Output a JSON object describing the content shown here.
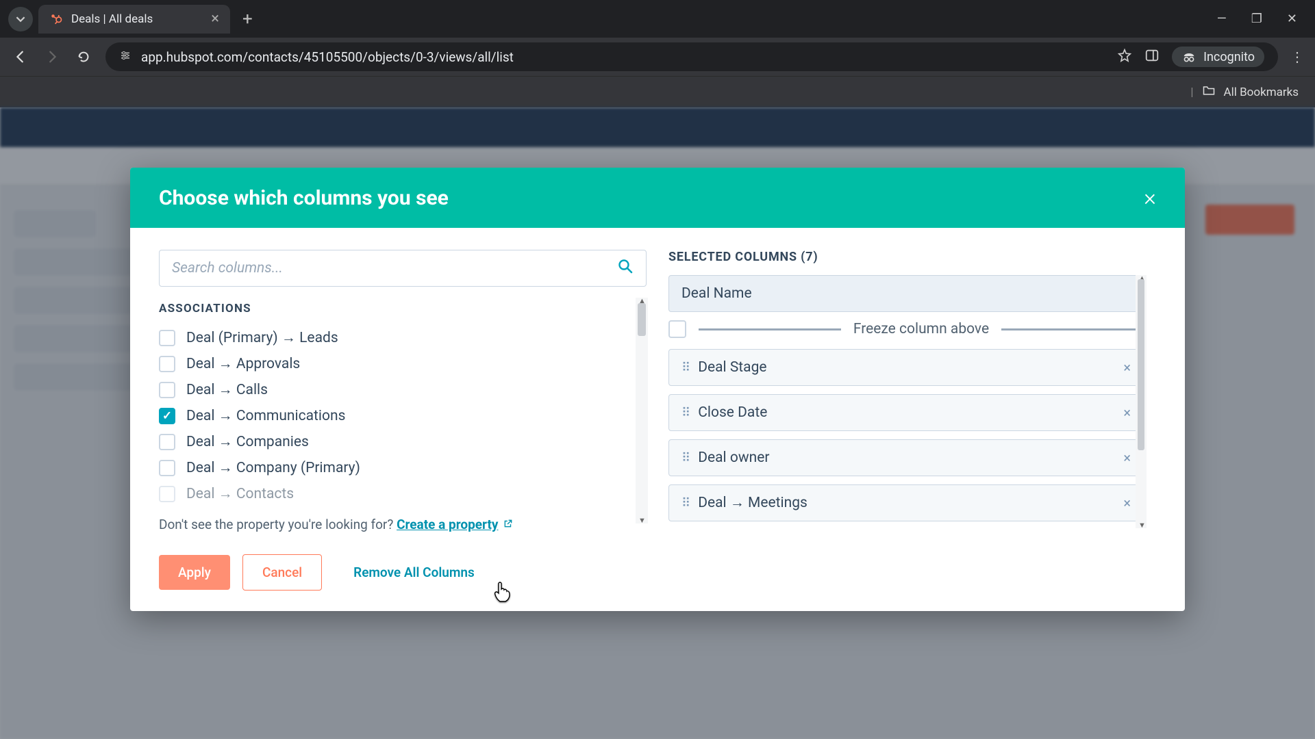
{
  "browser": {
    "tab_title": "Deals | All deals",
    "url": "app.hubspot.com/contacts/45105500/objects/0-3/views/all/list",
    "incognito_label": "Incognito",
    "all_bookmarks": "All Bookmarks"
  },
  "modal": {
    "title": "Choose which columns you see",
    "search_placeholder": "Search columns...",
    "section_label": "ASSOCIATIONS",
    "helper_prefix": "Don't see the property you're looking for? ",
    "helper_link": "Create a property",
    "associations": [
      {
        "label": "Deal (Primary) → Leads",
        "checked": false
      },
      {
        "label": "Deal → Approvals",
        "checked": false
      },
      {
        "label": "Deal → Calls",
        "checked": false
      },
      {
        "label": "Deal → Communications",
        "checked": true
      },
      {
        "label": "Deal → Companies",
        "checked": false
      },
      {
        "label": "Deal → Company (Primary)",
        "checked": false
      },
      {
        "label": "Deal → Contacts",
        "checked": false
      }
    ],
    "selected_title": "SELECTED COLUMNS (7)",
    "frozen_column": "Deal Name",
    "freeze_divider": "Freeze column above",
    "selected_columns": [
      "Deal Stage",
      "Close Date",
      "Deal owner",
      "Deal → Meetings"
    ],
    "apply": "Apply",
    "cancel": "Cancel",
    "remove_all": "Remove All Columns"
  }
}
